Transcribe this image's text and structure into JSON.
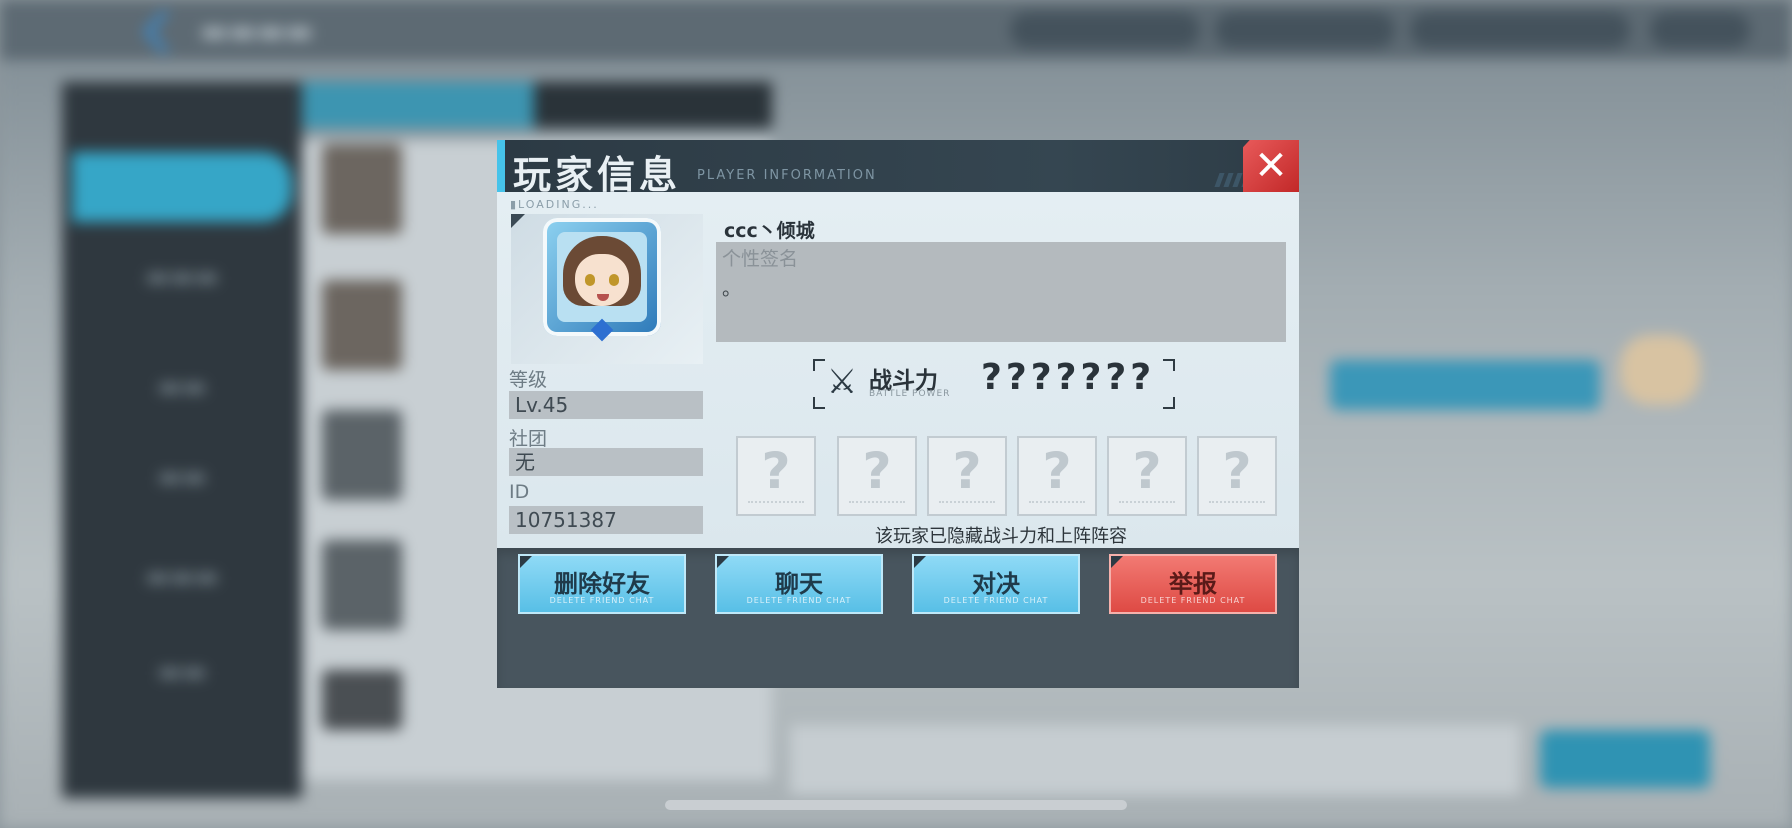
{
  "dialog": {
    "title": "玩家信息",
    "subtitle": "PLAYER INFORMATION",
    "close_icon": "✕"
  },
  "profile": {
    "loading": "▮LOADING...",
    "name": "ccc丶倾城",
    "signature_label": "个性签名",
    "signature": "。",
    "level_label": "等级",
    "level": "Lv.45",
    "club_label": "社团",
    "club": "无",
    "id_label": "ID",
    "id": "10751387"
  },
  "power": {
    "icon": "crossed-swords-icon",
    "label": "战斗力",
    "sub": "BATTLE POWER",
    "value": "???????"
  },
  "lineup": {
    "slots": [
      "?",
      "?",
      "?",
      "?",
      "?",
      "?"
    ],
    "hidden_note": "该玩家已隐藏战斗力和上阵阵容"
  },
  "actions": {
    "delete_friend": "删除好友",
    "chat": "聊天",
    "duel": "对决",
    "report": "举报",
    "sub_caption": "DELETE FRIEND CHAT"
  },
  "colors": {
    "accent": "#46c3ea",
    "button_blue": "#58bfe6",
    "button_red": "#de4a44",
    "close_red": "#c22828"
  }
}
